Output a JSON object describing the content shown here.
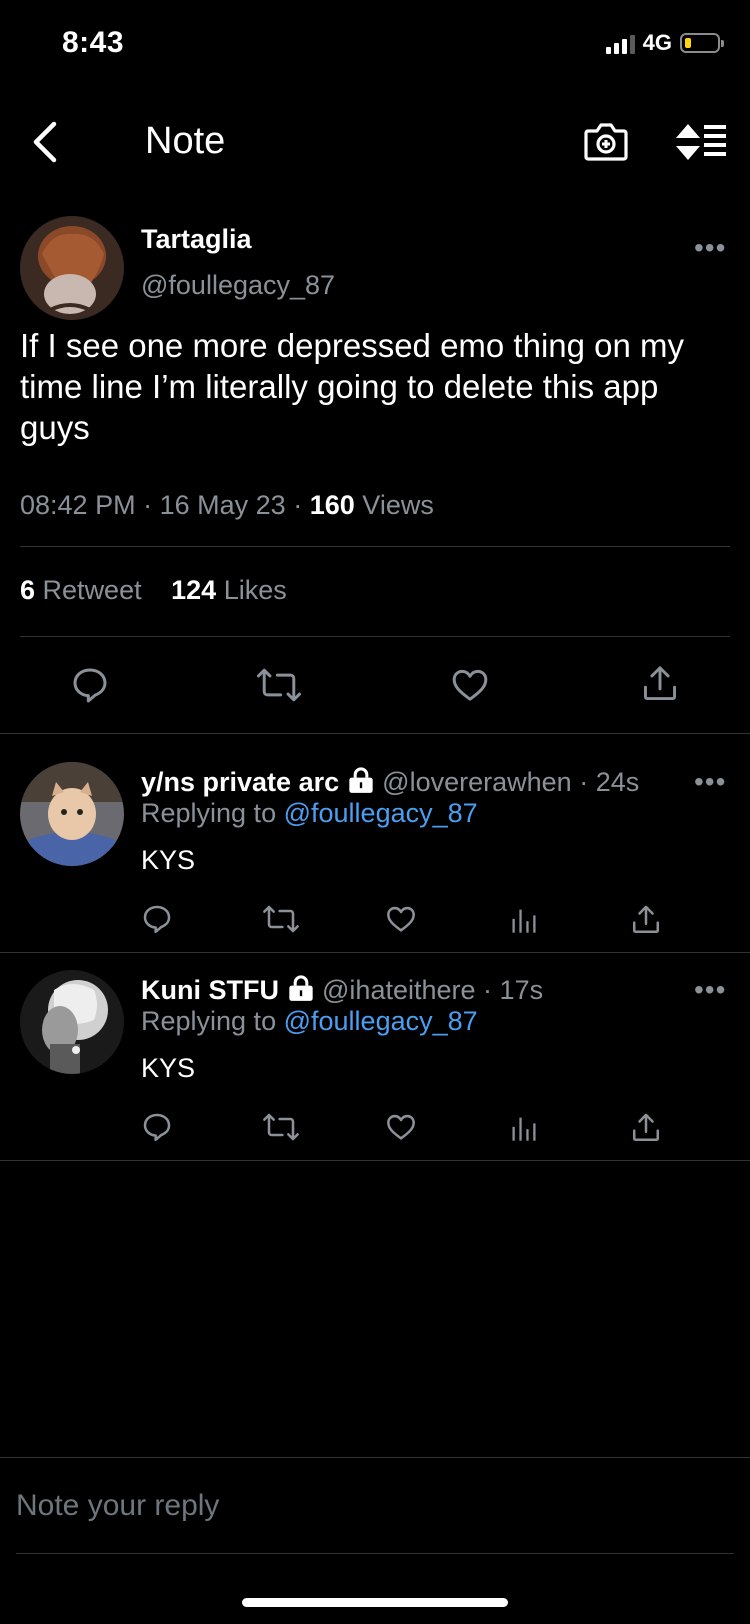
{
  "status": {
    "time": "8:43",
    "network": "4G",
    "battery_level": 0.2
  },
  "header": {
    "title": "Note"
  },
  "tweet": {
    "name": "Tartaglia",
    "handle": "@foullegacy_87",
    "text": "If I see one more depressed emo thing on my time line I’m literally going to delete this app guys",
    "time": "08:42 PM",
    "date": "16 May 23",
    "views": "160",
    "views_label": "Views",
    "retweets": "6",
    "retweets_label": "Retweet",
    "likes": "124",
    "likes_label": "Likes"
  },
  "replies": [
    {
      "name": "y/ns private arc",
      "handle": "@lovererawhen",
      "time": "24s",
      "replying_prefix": "Replying to",
      "replying_to": "@foullegacy_87",
      "text": "KYS"
    },
    {
      "name": "Kuni STFU",
      "handle": "@ihateithere",
      "time": "17s",
      "replying_prefix": "Replying to",
      "replying_to": "@foullegacy_87",
      "text": "KYS"
    }
  ],
  "separator": "·",
  "reply_input": {
    "placeholder": "Note your reply"
  },
  "colors": {
    "link": "#4c9ef0",
    "muted": "#8b9198",
    "divider": "#2f3336",
    "background": "#000000"
  }
}
